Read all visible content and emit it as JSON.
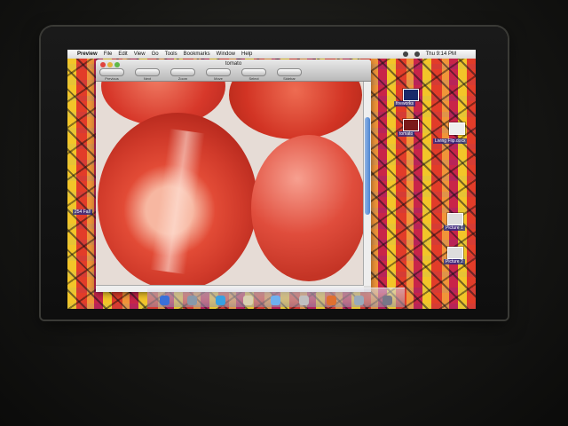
{
  "menubar": {
    "app_name": "Preview",
    "items": [
      "File",
      "Edit",
      "View",
      "Go",
      "Tools",
      "Bookmarks",
      "Window",
      "Help"
    ],
    "clock": "Thu 9:14 PM"
  },
  "window": {
    "title": "tomato",
    "toolbar": [
      "Previous",
      "Next",
      "Zoom",
      "Move",
      "Select",
      "Sidebar"
    ]
  },
  "desktop_icons": [
    {
      "label": "fireworks"
    },
    {
      "label": "tomato"
    },
    {
      "label": "Living Flip.docx"
    },
    {
      "label": "Picture 1"
    },
    {
      "label": "Picture 2"
    },
    {
      "label": "254 Fall"
    }
  ]
}
